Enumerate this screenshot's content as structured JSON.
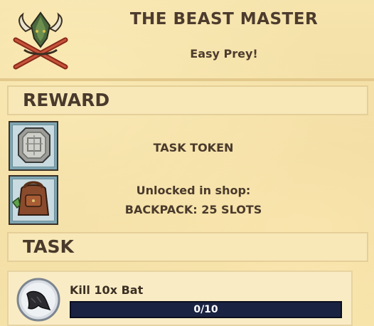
{
  "header": {
    "title": "THE BEAST MASTER",
    "subtitle": "Easy Prey!",
    "emblem_icon": "horned-beast-crest-icon"
  },
  "reward": {
    "heading": "REWARD",
    "items": [
      {
        "icon": "task-token-icon",
        "lines": [
          "TASK TOKEN"
        ]
      },
      {
        "icon": "backpack-icon",
        "lines": [
          "Unlocked in shop:",
          "BACKPACK: 25 SLOTS"
        ]
      }
    ]
  },
  "task": {
    "heading": "TASK",
    "icon": "bat-icon",
    "name": "Kill 10x Bat",
    "progress_text": "0/10",
    "progress_current": 0,
    "progress_total": 10
  },
  "colors": {
    "parchment": "#f3dfa7",
    "text": "#4a3a2c",
    "progress_track": "#1a2342",
    "progress_fill": "#3f5fa8"
  }
}
